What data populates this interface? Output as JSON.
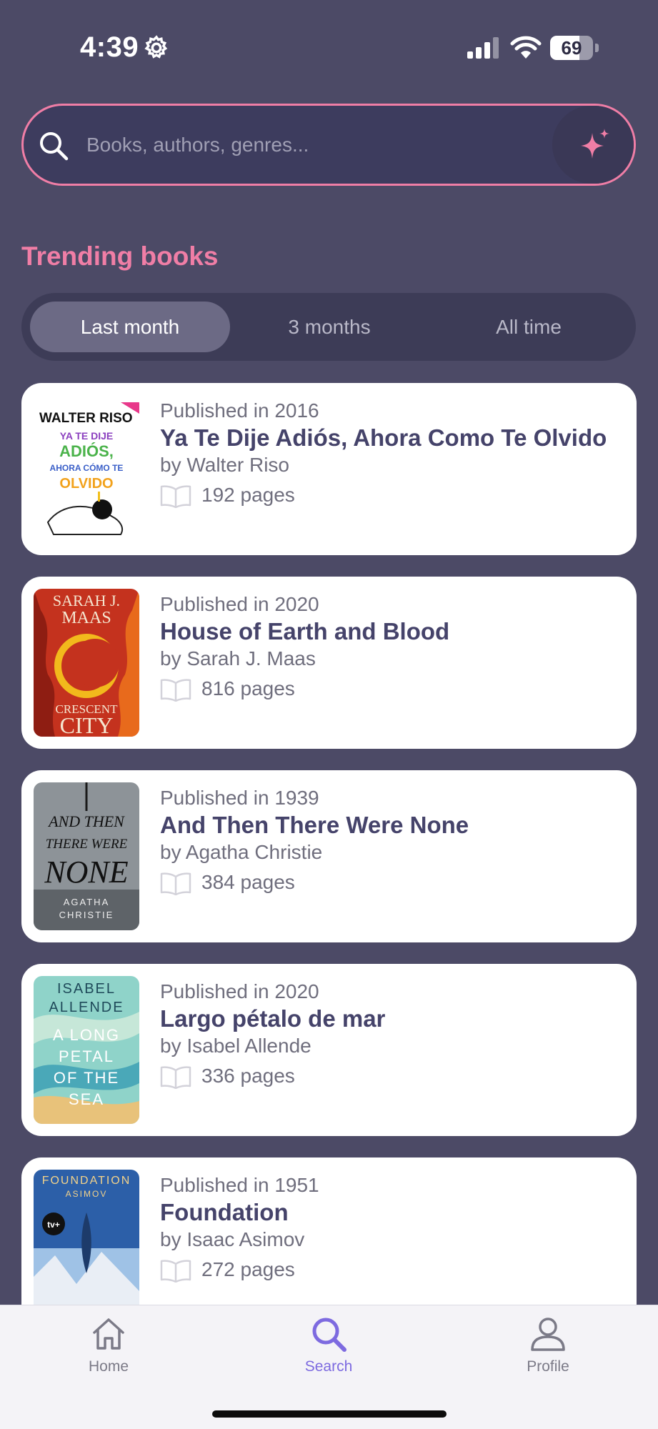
{
  "status_bar": {
    "time": "4:39",
    "battery_level": "69",
    "battery_fraction": 0.69,
    "icons": [
      "gear-icon",
      "cellular-signal-icon",
      "wifi-icon",
      "battery-icon"
    ]
  },
  "search": {
    "placeholder": "Books, authors, genres...",
    "value": "",
    "icon": "search-icon",
    "ai_button_icon": "sparkle-icon"
  },
  "section": {
    "title": "Trending books"
  },
  "time_filter": {
    "options": [
      "Last month",
      "3 months",
      "All time"
    ],
    "selected": "Last month"
  },
  "books": [
    {
      "year_text": "Published in 2016",
      "title": "Ya Te Dije Adiós, Ahora Como Te Olvido",
      "author_text": "by Walter Riso",
      "pages_text": "192 pages"
    },
    {
      "year_text": "Published in 2020",
      "title": "House of Earth and Blood",
      "author_text": "by Sarah J. Maas",
      "pages_text": "816 pages"
    },
    {
      "year_text": "Published in 1939",
      "title": "And Then There Were None",
      "author_text": "by Agatha Christie",
      "pages_text": "384 pages"
    },
    {
      "year_text": "Published in 2020",
      "title": "Largo pétalo de mar",
      "author_text": "by Isabel Allende",
      "pages_text": "336 pages"
    },
    {
      "year_text": "Published in 1951",
      "title": "Foundation",
      "author_text": "by Isaac Asimov",
      "pages_text": "272 pages"
    }
  ],
  "covers": [
    {
      "lines": [
        "WALTER RISO",
        "YA TE DIJE",
        "ADIÓS,",
        "AHORA CÓMO TE",
        "OLVIDO"
      ]
    },
    {
      "lines": [
        "SARAH J.",
        "MAAS",
        "CRESCENT",
        "CITY"
      ]
    },
    {
      "lines": [
        "AND THEN",
        "THERE WERE",
        "NONE",
        "AGATHA",
        "CHRISTIE"
      ]
    },
    {
      "lines": [
        "ISABEL",
        "ALLENDE",
        "A LONG",
        "PETAL",
        "OF THE",
        "SEA"
      ]
    },
    {
      "lines": [
        "FOUNDATION",
        "ASIMOV",
        "tv+"
      ]
    }
  ],
  "tab_bar": {
    "tabs": [
      {
        "label": "Home",
        "icon": "home-icon"
      },
      {
        "label": "Search",
        "icon": "search-icon"
      },
      {
        "label": "Profile",
        "icon": "profile-icon"
      }
    ],
    "active": "Search"
  },
  "colors": {
    "background": "#4c4a66",
    "accent_pink": "#f07ea6",
    "active_tab": "#7d6ae0",
    "card": "#ffffff"
  }
}
